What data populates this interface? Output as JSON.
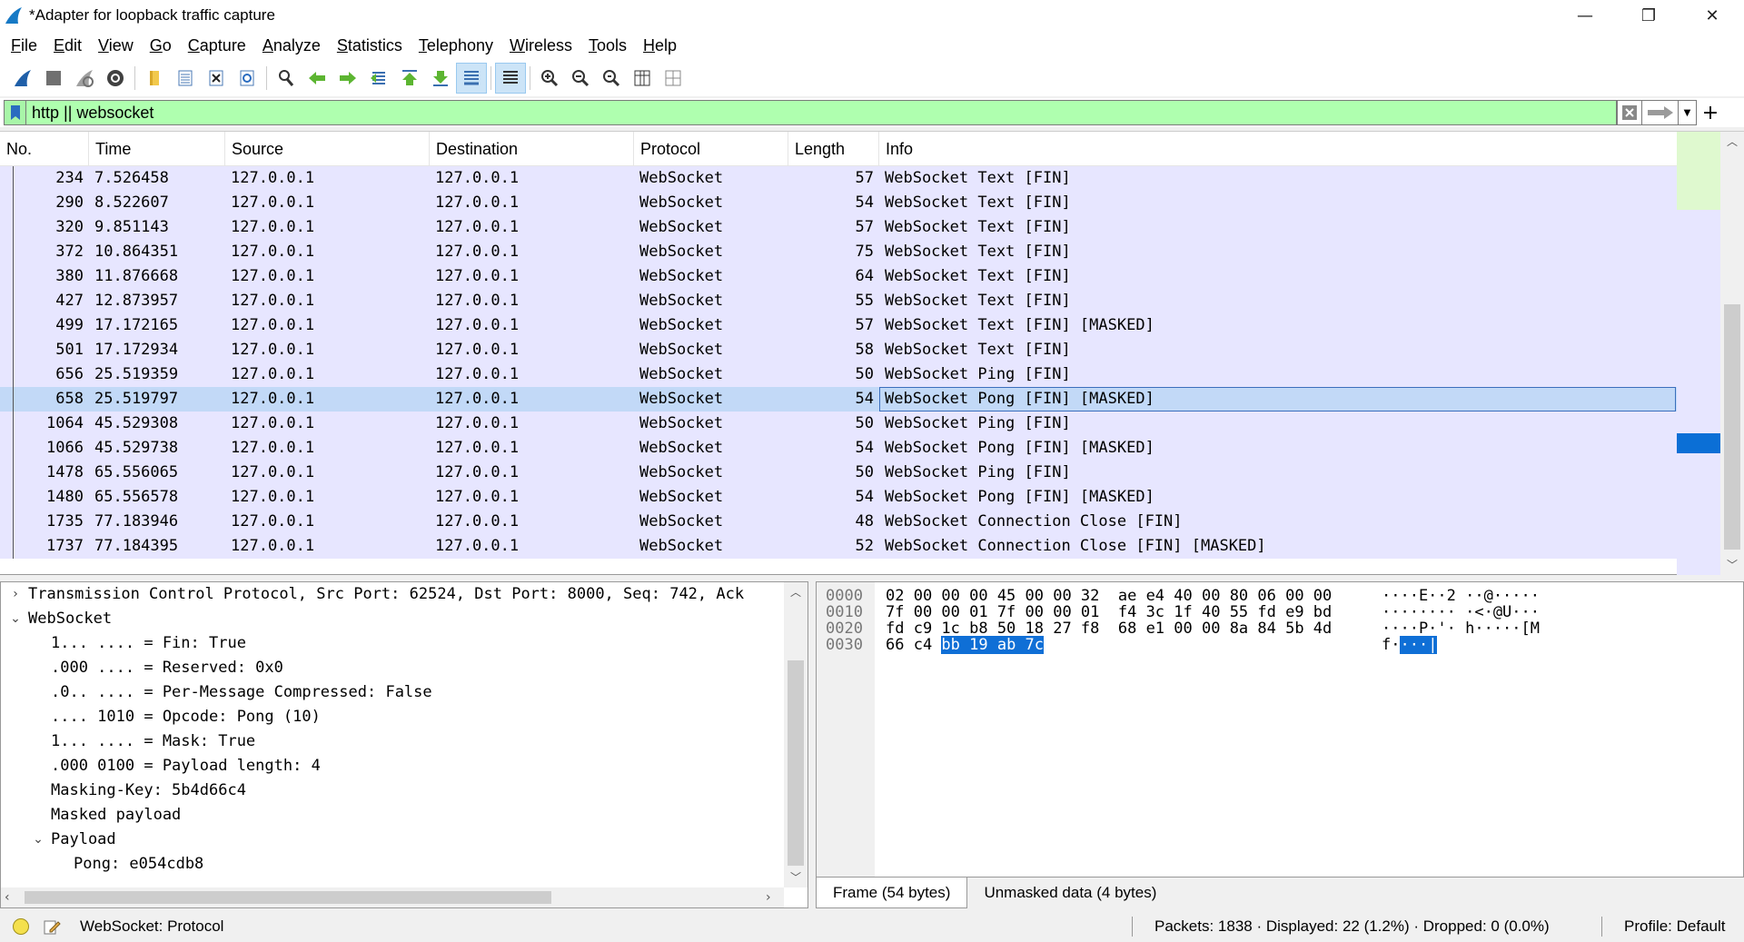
{
  "window": {
    "title": "*Adapter for loopback traffic capture",
    "minimize": "—",
    "restore": "❐",
    "close": "✕"
  },
  "menu": [
    "File",
    "Edit",
    "View",
    "Go",
    "Capture",
    "Analyze",
    "Statistics",
    "Telephony",
    "Wireless",
    "Tools",
    "Help"
  ],
  "toolbar": {
    "icons": [
      "start-capture-icon",
      "stop-capture-icon",
      "restart-capture-icon",
      "capture-options-icon",
      "open-file-icon",
      "save-file-icon",
      "close-file-icon",
      "reload-file-icon",
      "find-packet-icon",
      "go-back-icon",
      "go-forward-icon",
      "go-to-packet-icon",
      "first-packet-icon",
      "last-packet-icon",
      "autoscroll-icon",
      "colorize-icon",
      "zoom-in-icon",
      "zoom-out-icon",
      "normal-size-icon",
      "resize-columns-icon",
      "layout-icon"
    ]
  },
  "filter": {
    "value": "http || websocket",
    "add_label": "+"
  },
  "packet_list": {
    "columns": [
      "No.",
      "Time",
      "Source",
      "Destination",
      "Protocol",
      "Length",
      "Info"
    ],
    "rows": [
      {
        "no": "234",
        "time": "7.526458",
        "src": "127.0.0.1",
        "dst": "127.0.0.1",
        "proto": "WebSocket",
        "len": "57",
        "info": "WebSocket Text [FIN]"
      },
      {
        "no": "290",
        "time": "8.522607",
        "src": "127.0.0.1",
        "dst": "127.0.0.1",
        "proto": "WebSocket",
        "len": "54",
        "info": "WebSocket Text [FIN]"
      },
      {
        "no": "320",
        "time": "9.851143",
        "src": "127.0.0.1",
        "dst": "127.0.0.1",
        "proto": "WebSocket",
        "len": "57",
        "info": "WebSocket Text [FIN]"
      },
      {
        "no": "372",
        "time": "10.864351",
        "src": "127.0.0.1",
        "dst": "127.0.0.1",
        "proto": "WebSocket",
        "len": "75",
        "info": "WebSocket Text [FIN]"
      },
      {
        "no": "380",
        "time": "11.876668",
        "src": "127.0.0.1",
        "dst": "127.0.0.1",
        "proto": "WebSocket",
        "len": "64",
        "info": "WebSocket Text [FIN]"
      },
      {
        "no": "427",
        "time": "12.873957",
        "src": "127.0.0.1",
        "dst": "127.0.0.1",
        "proto": "WebSocket",
        "len": "55",
        "info": "WebSocket Text [FIN]"
      },
      {
        "no": "499",
        "time": "17.172165",
        "src": "127.0.0.1",
        "dst": "127.0.0.1",
        "proto": "WebSocket",
        "len": "57",
        "info": "WebSocket Text [FIN] [MASKED]"
      },
      {
        "no": "501",
        "time": "17.172934",
        "src": "127.0.0.1",
        "dst": "127.0.0.1",
        "proto": "WebSocket",
        "len": "58",
        "info": "WebSocket Text [FIN]"
      },
      {
        "no": "656",
        "time": "25.519359",
        "src": "127.0.0.1",
        "dst": "127.0.0.1",
        "proto": "WebSocket",
        "len": "50",
        "info": "WebSocket Ping [FIN]"
      },
      {
        "no": "658",
        "time": "25.519797",
        "src": "127.0.0.1",
        "dst": "127.0.0.1",
        "proto": "WebSocket",
        "len": "54",
        "info": "WebSocket Pong [FIN] [MASKED]"
      },
      {
        "no": "1064",
        "time": "45.529308",
        "src": "127.0.0.1",
        "dst": "127.0.0.1",
        "proto": "WebSocket",
        "len": "50",
        "info": "WebSocket Ping [FIN]"
      },
      {
        "no": "1066",
        "time": "45.529738",
        "src": "127.0.0.1",
        "dst": "127.0.0.1",
        "proto": "WebSocket",
        "len": "54",
        "info": "WebSocket Pong [FIN] [MASKED]"
      },
      {
        "no": "1478",
        "time": "65.556065",
        "src": "127.0.0.1",
        "dst": "127.0.0.1",
        "proto": "WebSocket",
        "len": "50",
        "info": "WebSocket Ping [FIN]"
      },
      {
        "no": "1480",
        "time": "65.556578",
        "src": "127.0.0.1",
        "dst": "127.0.0.1",
        "proto": "WebSocket",
        "len": "54",
        "info": "WebSocket Pong [FIN] [MASKED]"
      },
      {
        "no": "1735",
        "time": "77.183946",
        "src": "127.0.0.1",
        "dst": "127.0.0.1",
        "proto": "WebSocket",
        "len": "48",
        "info": "WebSocket Connection Close [FIN]"
      },
      {
        "no": "1737",
        "time": "77.184395",
        "src": "127.0.0.1",
        "dst": "127.0.0.1",
        "proto": "WebSocket",
        "len": "52",
        "info": "WebSocket Connection Close [FIN] [MASKED]"
      }
    ],
    "selected_no": "658",
    "row_color": "#e7e6ff",
    "selected_color": "#c2d9f7"
  },
  "details": {
    "lines": [
      {
        "text": "Transmission Control Protocol, Src Port: 62524, Dst Port: 8000, Seq: 742, Ack",
        "arrow": "›",
        "level": 0
      },
      {
        "text": "WebSocket",
        "arrow": "⌄",
        "level": 0
      },
      {
        "text": "1... .... = Fin: True",
        "arrow": "",
        "level": 1
      },
      {
        "text": ".000 .... = Reserved: 0x0",
        "arrow": "",
        "level": 1
      },
      {
        "text": ".0.. .... = Per-Message Compressed: False",
        "arrow": "",
        "level": 1
      },
      {
        "text": ".... 1010 = Opcode: Pong (10)",
        "arrow": "",
        "level": 1
      },
      {
        "text": "1... .... = Mask: True",
        "arrow": "",
        "level": 1
      },
      {
        "text": ".000 0100 = Payload length: 4",
        "arrow": "",
        "level": 1
      },
      {
        "text": "Masking-Key: 5b4d66c4",
        "arrow": "",
        "level": 1
      },
      {
        "text": "Masked payload",
        "arrow": "",
        "level": 1
      },
      {
        "text": "Payload",
        "arrow": "⌄",
        "level": 1
      },
      {
        "text": "Pong: e054cdb8",
        "arrow": "",
        "level": 2
      }
    ]
  },
  "bytes": {
    "lines": [
      {
        "offset": "0000",
        "hex": "02 00 00 00 45 00 00 32  ae e4 40 00 80 06 00 00",
        "hex_hl": "",
        "ascii": "····E··2 ··@·····",
        "ascii_hl": ""
      },
      {
        "offset": "0010",
        "hex": "7f 00 00 01 7f 00 00 01  f4 3c 1f 40 55 fd e9 bd",
        "hex_hl": "",
        "ascii": "········ ·<·@U···",
        "ascii_hl": ""
      },
      {
        "offset": "0020",
        "hex": "fd c9 1c b8 50 18 27 f8  68 e1 00 00 8a 84 5b 4d",
        "hex_hl": "",
        "ascii": "····P·'· h·····[M",
        "ascii_hl": ""
      },
      {
        "offset": "0030",
        "hex": "66 c4 ",
        "hex_hl": "bb 19 ab 7c",
        "ascii": "f·",
        "ascii_hl": "···|"
      }
    ],
    "tabs": [
      "Frame (54 bytes)",
      "Unmasked data (4 bytes)"
    ]
  },
  "status": {
    "text": "WebSocket: Protocol",
    "packets": "Packets: 1838 · Displayed: 22 (1.2%) · Dropped: 0 (0.0%)",
    "profile": "Profile: Default"
  }
}
